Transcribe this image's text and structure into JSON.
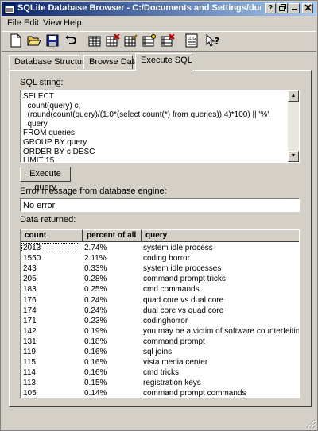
{
  "window": {
    "title": "SQLite Database Browser - C:/Documents and Settings/dude/Desktop/queries.db"
  },
  "menu": [
    "File",
    "Edit",
    "View",
    "Help"
  ],
  "toolbar": [
    "new-database-icon",
    "open-database-icon",
    "save-icon",
    "undo-icon",
    "create-table-icon",
    "delete-table-icon",
    "modify-table-icon",
    "create-index-icon",
    "delete-index-icon",
    "sql-log-icon",
    "whats-this-icon"
  ],
  "tabs": [
    {
      "label": "Database Structure"
    },
    {
      "label": "Browse Data"
    },
    {
      "label": "Execute SQL",
      "active": true
    }
  ],
  "sql": {
    "label": "SQL string:",
    "lines": [
      "SELECT",
      "  count(query) c,",
      "  (round(count(query)/(1.0*(select count(*) from queries)),4)*100) || '%',",
      "  query",
      "FROM queries",
      "GROUP BY query",
      "ORDER BY c DESC",
      "LIMIT 15"
    ]
  },
  "execute_button": "Execute query",
  "error": {
    "label": "Error message from database engine:",
    "value": "No error"
  },
  "results": {
    "label": "Data returned:",
    "columns": [
      "count",
      "percent of all",
      "query"
    ],
    "rows": [
      [
        "2013",
        "2.74%",
        "system idle process"
      ],
      [
        "1550",
        "2.11%",
        "coding horror"
      ],
      [
        "243",
        "0.33%",
        "system idle processes"
      ],
      [
        "205",
        "0.28%",
        "command prompt tricks"
      ],
      [
        "183",
        "0.25%",
        "cmd commands"
      ],
      [
        "176",
        "0.24%",
        "quad core vs dual core"
      ],
      [
        "174",
        "0.24%",
        "dual core vs quad core"
      ],
      [
        "171",
        "0.23%",
        "codinghorror"
      ],
      [
        "142",
        "0.19%",
        "you may be a victim of software counterfeiting"
      ],
      [
        "131",
        "0.18%",
        "command prompt"
      ],
      [
        "119",
        "0.16%",
        "sql joins"
      ],
      [
        "115",
        "0.16%",
        "vista media center"
      ],
      [
        "114",
        "0.16%",
        "cmd tricks"
      ],
      [
        "113",
        "0.15%",
        "registration keys"
      ],
      [
        "105",
        "0.14%",
        "command prompt commands"
      ]
    ]
  },
  "colors": {
    "titlebar_start": "#0a246a",
    "titlebar_end": "#a6caf0",
    "face": "#d4d0c8"
  }
}
